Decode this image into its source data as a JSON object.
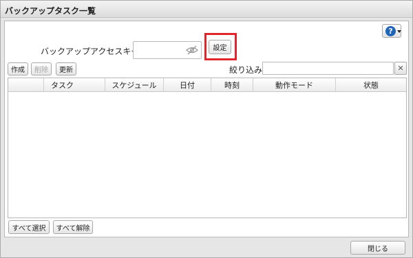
{
  "window": {
    "title": "バックアップタスク一覧"
  },
  "help": {
    "symbol": "?",
    "icon": "help-icon",
    "accent": "#1f65b8"
  },
  "access_key": {
    "label": "バックアップアクセスキー:",
    "value": "",
    "eye_icon": "eye-slash-icon"
  },
  "buttons": {
    "set": "設定",
    "create": "作成",
    "delete": "削除",
    "refresh": "更新",
    "select_all": "すべて選択",
    "deselect_all": "すべて解除",
    "close": "閉じる"
  },
  "filter": {
    "label": "絞り込み:",
    "value": "",
    "clear_symbol": "✕"
  },
  "table": {
    "columns": [
      "",
      "タスク",
      "スケジュール",
      "日付",
      "時刻",
      "動作モード",
      "状態"
    ],
    "rows": []
  },
  "colors": {
    "highlight": "#e0262b"
  }
}
